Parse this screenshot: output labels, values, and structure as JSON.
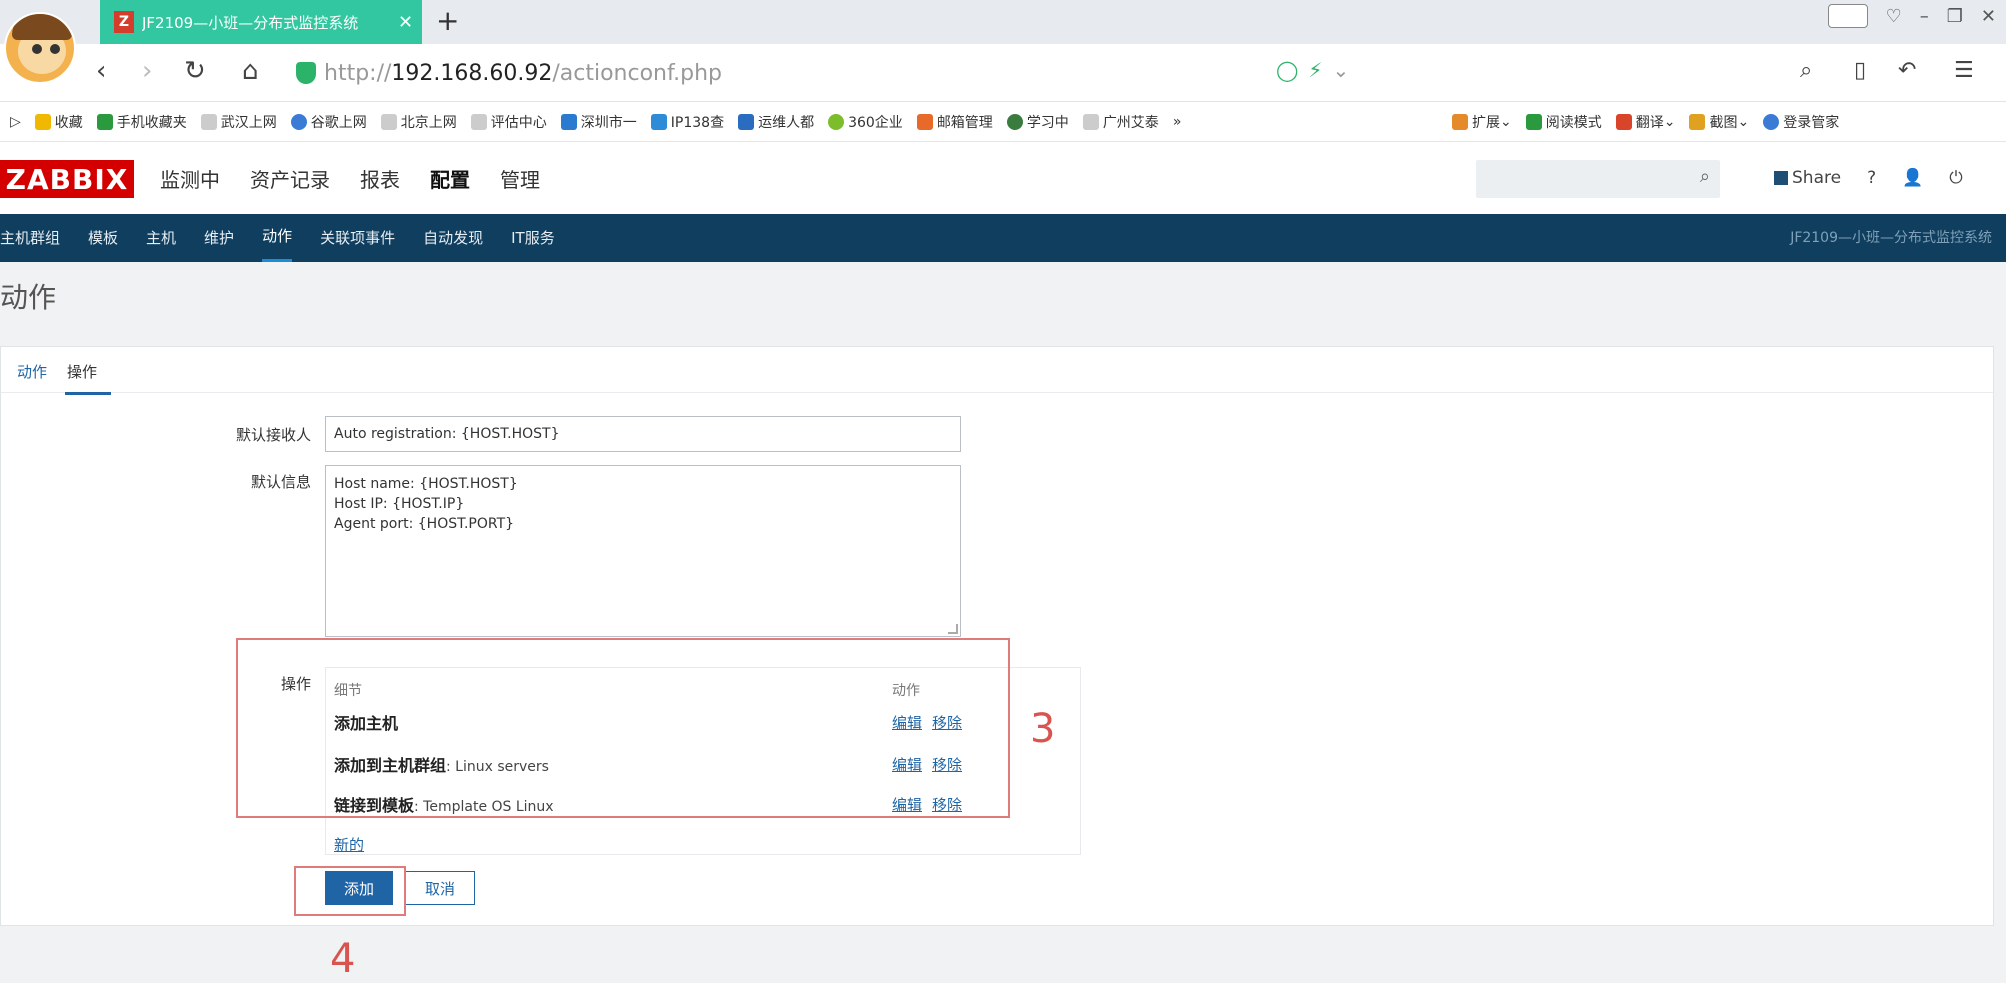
{
  "browser": {
    "tab_title": "JF2109—小班—分布式监控系统",
    "tab_favicon": "Z",
    "url_prefix": "http://",
    "url_host": "192.168.60.92",
    "url_path": "/actionconf.php"
  },
  "bookmarks": [
    {
      "label": "收藏",
      "icon_color": "#f0b800"
    },
    {
      "label": "手机收藏夹",
      "icon_color": "#2b9a3e"
    },
    {
      "label": "武汉上网",
      "icon_color": "#cccccc"
    },
    {
      "label": "谷歌上网",
      "icon_color": "#3a7bd5"
    },
    {
      "label": "北京上网",
      "icon_color": "#cccccc"
    },
    {
      "label": "评估中心",
      "icon_color": "#cccccc"
    },
    {
      "label": "深圳市一",
      "icon_color": "#2a7bd0"
    },
    {
      "label": "IP138查",
      "icon_color": "#2e8bd8"
    },
    {
      "label": "运维人都",
      "icon_color": "#2a6cc0"
    },
    {
      "label": "360企业",
      "icon_color": "#7bbd2a"
    },
    {
      "label": "邮箱管理",
      "icon_color": "#e86a2a"
    },
    {
      "label": "学习中",
      "icon_color": "#3a7b3e"
    },
    {
      "label": "广州艾泰",
      "icon_color": "#cccccc"
    }
  ],
  "bookmarks_right": [
    {
      "label": "扩展",
      "icon_color": "#e58a2a"
    },
    {
      "label": "阅读模式",
      "icon_color": "#2b9a3e"
    },
    {
      "label": "翻译",
      "icon_color": "#d9452a"
    },
    {
      "label": "截图",
      "icon_color": "#e0a020"
    },
    {
      "label": "登录管家",
      "icon_color": "#3a7bd5"
    }
  ],
  "zabbix": {
    "logo": "ZABBIX",
    "menu": [
      "监测中",
      "资产记录",
      "报表",
      "配置",
      "管理"
    ],
    "share": "Share",
    "help": "?",
    "subnav": [
      "主机群组",
      "模板",
      "主机",
      "维护",
      "动作",
      "关联项事件",
      "自动发现",
      "IT服务"
    ],
    "system_name": "JF2109—小班—分布式监控系统"
  },
  "page": {
    "title": "动作",
    "tabs": [
      "动作",
      "操作"
    ],
    "form": {
      "default_subject_label": "默认接收人",
      "default_subject_value": "Auto registration: {HOST.HOST}",
      "default_message_label": "默认信息",
      "default_message_lines": [
        "Host name: {HOST.HOST}",
        "Host IP: {HOST.IP}",
        "Agent port: {HOST.PORT}"
      ],
      "operations_label": "操作",
      "ops_col_details": "细节",
      "ops_col_action": "动作",
      "operations": [
        {
          "name": "添加主机",
          "detail": ""
        },
        {
          "name": "添加到主机群组",
          "detail": ": Linux servers"
        },
        {
          "name": "链接到模板",
          "detail": ": Template OS Linux"
        }
      ],
      "op_edit": "编辑",
      "op_remove": "移除",
      "new_link": "新的",
      "add_button": "添加",
      "cancel_button": "取消"
    }
  },
  "annotations": {
    "label_3": "3",
    "label_4": "4"
  }
}
